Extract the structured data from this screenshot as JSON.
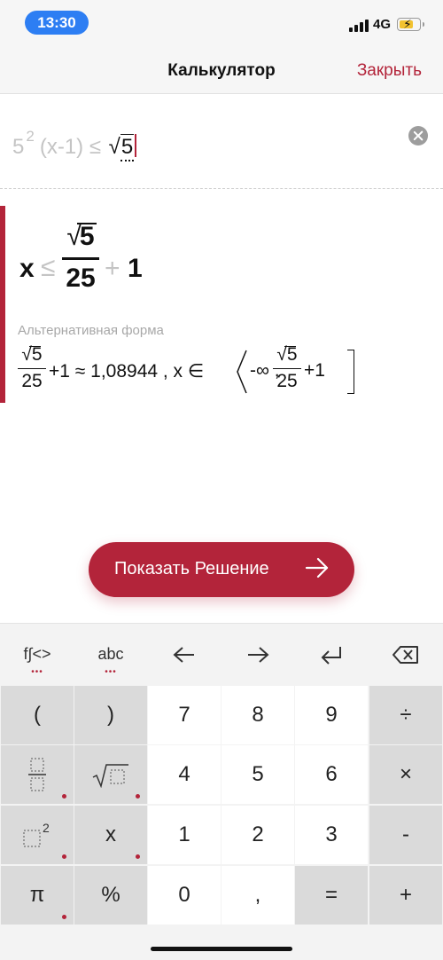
{
  "status_bar": {
    "time": "13:30",
    "network": "4G"
  },
  "nav": {
    "title": "Калькулятор",
    "close_label": "Закрыть"
  },
  "input": {
    "base": "5",
    "exponent": "2",
    "rest": "(x-1) ≤",
    "radicand": "5"
  },
  "result": {
    "variable": "x",
    "relation": "≤",
    "numerator_root": "√",
    "numerator": "5",
    "denominator": "25",
    "plus": "+",
    "addend": "1",
    "alt_label": "Альтернативная форма",
    "alt": {
      "f1_num": "√5",
      "f1_den": "25",
      "approx_text": "+1 ≈ 1,08944 , x ∈",
      "interval_start": "-∞ ,",
      "f2_num": "√5",
      "f2_den": "25",
      "interval_end": "+1"
    }
  },
  "solve_button": {
    "label": "Показать Решение"
  },
  "keyboard": {
    "toolbar": {
      "functions": "f∫<>",
      "letters": "abc",
      "left": "←",
      "right": "→",
      "enter": "↵",
      "backspace": "⌫"
    },
    "keys": {
      "lparen": "(",
      "rparen": ")",
      "seven": "7",
      "eight": "8",
      "nine": "9",
      "divide": "÷",
      "sqrt": "√",
      "four": "4",
      "five": "5",
      "six": "6",
      "multiply": "×",
      "var_x": "x",
      "one": "1",
      "two": "2",
      "three": "3",
      "minus": "-",
      "pi": "π",
      "percent": "%",
      "zero": "0",
      "comma": ",",
      "equals": "=",
      "plus": "+"
    }
  }
}
